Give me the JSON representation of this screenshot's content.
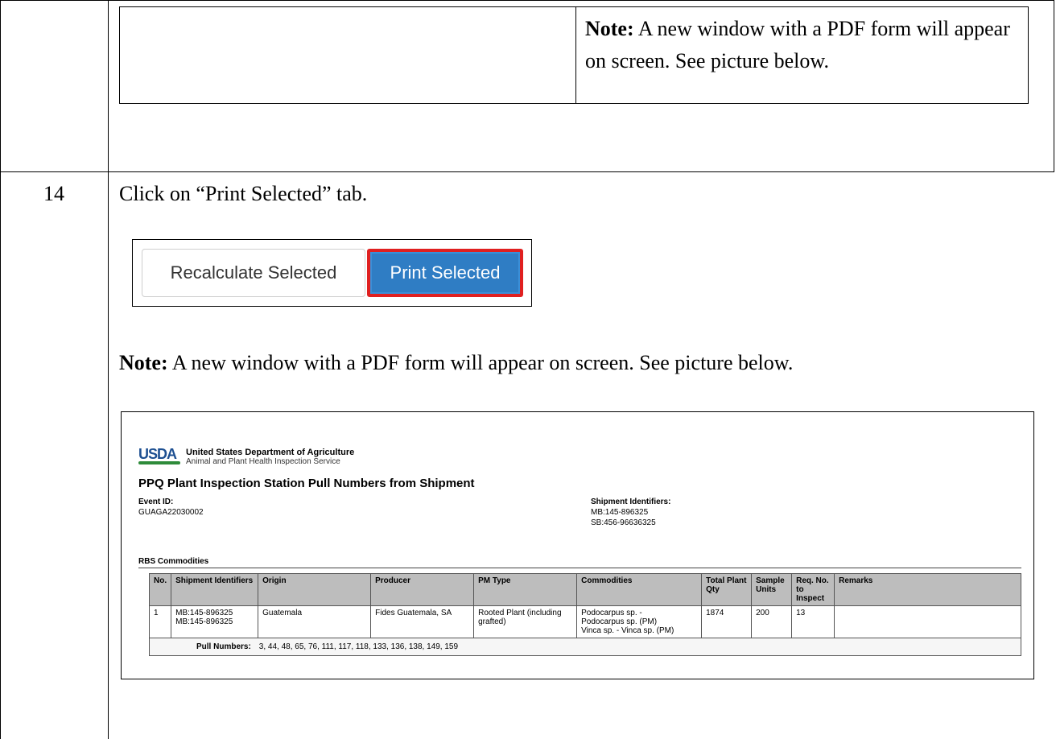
{
  "top_note": {
    "bold": "Note:",
    "text": " A new window with a PDF form will appear on screen. See picture below."
  },
  "step": {
    "number": "14",
    "instruction": "Click on “Print Selected” tab."
  },
  "buttons": {
    "recalculate": "Recalculate Selected",
    "print": "Print Selected",
    "highlight_color": "#e02020",
    "print_color": "#2f7dc4"
  },
  "note2": {
    "bold": "Note:",
    "text": " A new window with a PDF form will appear on screen. See picture below."
  },
  "pdf": {
    "logo": "USDA",
    "agency_line1": "United States Department of Agriculture",
    "agency_line2": "Animal and Plant Health Inspection Service",
    "title": "PPQ Plant Inspection Station Pull Numbers from Shipment",
    "event_id_label": "Event ID:",
    "event_id": "GUAGA22030002",
    "shipment_label": "Shipment Identifiers:",
    "shipment_ids": [
      "MB:145-896325",
      "SB:456-96636325"
    ],
    "section": "RBS Commodities",
    "columns": [
      "No.",
      "Shipment Identifiers",
      "Origin",
      "Producer",
      "PM Type",
      "Commodities",
      "Total Plant Qty",
      "Sample Units",
      "Req. No. to Inspect",
      "Remarks"
    ],
    "rows": [
      {
        "no": "1",
        "shipment": "MB:145-896325\nMB:145-896325",
        "origin": "Guatemala",
        "producer": "Fides Guatemala, SA",
        "pm_type": "Rooted Plant (including grafted)",
        "commodities": "Podocarpus sp. -\nPodocarpus sp. (PM)\nVinca sp. - Vinca sp. (PM)",
        "total_qty": "1874",
        "sample_units": "200",
        "req_no": "13",
        "remarks": ""
      }
    ],
    "pull_label": "Pull Numbers:",
    "pull_numbers": "3, 44, 48, 65, 76, 111, 117, 118, 133, 136, 138, 149, 159"
  }
}
